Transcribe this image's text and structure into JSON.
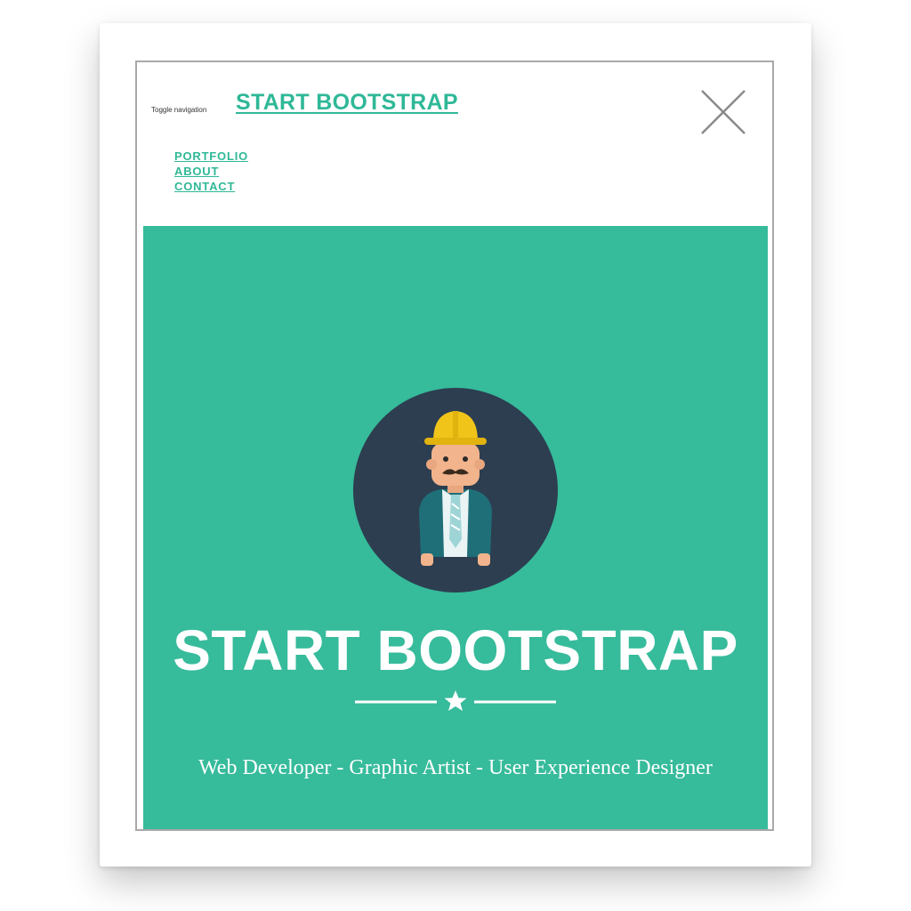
{
  "navbar": {
    "toggle_label": "Toggle navigation",
    "brand": "START BOOTSTRAP",
    "menu": [
      "PORTFOLIO",
      "ABOUT",
      "CONTACT"
    ],
    "close_icon": "close-icon"
  },
  "hero": {
    "avatar_icon": "developer-avatar-icon",
    "title": "START BOOTSTRAP",
    "divider_icon": "star-icon",
    "skills": "Web Developer - Graphic Artist - User Experience Designer"
  },
  "colors": {
    "accent": "#2fb897",
    "hero_bg": "#36bb9b",
    "avatar_bg": "#2c3e50",
    "hardhat": "#f0c419"
  }
}
